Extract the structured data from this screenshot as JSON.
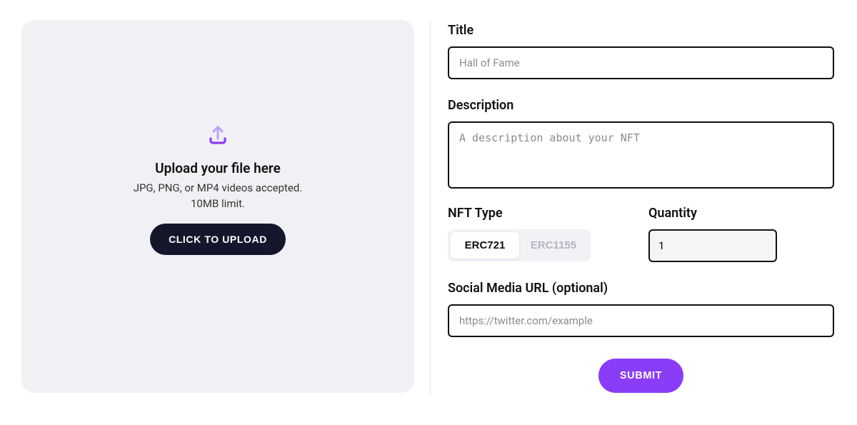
{
  "upload": {
    "title": "Upload your file here",
    "accepted": "JPG, PNG, or MP4 videos accepted.",
    "limit": "10MB limit.",
    "button": "CLICK TO UPLOAD"
  },
  "form": {
    "title_label": "Title",
    "title_placeholder": "Hall of Fame",
    "description_label": "Description",
    "description_placeholder": "A description about your NFT",
    "nft_type_label": "NFT Type",
    "nft_types": {
      "erc721": "ERC721",
      "erc1155": "ERC1155"
    },
    "nft_type_selected": "ERC721",
    "quantity_label": "Quantity",
    "quantity_value": "1",
    "social_label": "Social Media URL (optional)",
    "social_placeholder": "https://twitter.com/example",
    "submit": "SUBMIT"
  },
  "colors": {
    "accent": "#8a3cf7",
    "upload_icon_top": "#c2a6f5",
    "upload_icon_bottom": "#8a3cf7"
  }
}
